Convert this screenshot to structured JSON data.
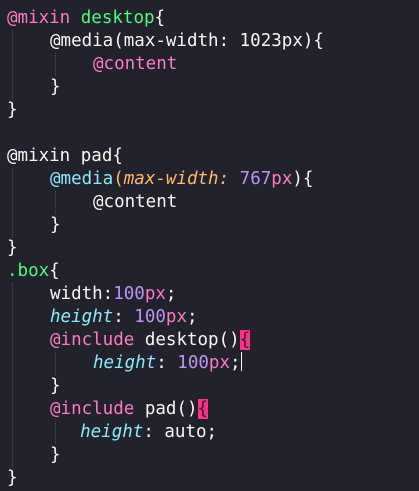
{
  "colors": {
    "background": "#21222c",
    "default_text": "#f8f8f2",
    "pink_keyword": "#ff79c6",
    "green_name": "#50fa7b",
    "cyan_property": "#8be9fd",
    "orange_param": "#ffb86c",
    "purple_number": "#bd93f9",
    "bracket_match_highlight": "#ff2e88",
    "indent_guide": "#4a4c5e"
  },
  "lines": [
    {
      "indent": 0,
      "tokens": [
        {
          "text": "@mixin",
          "color": "#ff79c6"
        },
        {
          "text": " "
        },
        {
          "text": "desktop",
          "color": "#50fa7b"
        },
        {
          "text": "{"
        }
      ]
    },
    {
      "indent": 1,
      "tokens": [
        {
          "text": "@media(max-width: 1023px){"
        }
      ]
    },
    {
      "indent": 2,
      "tokens": [
        {
          "text": "@content",
          "color": "#ff79c6"
        }
      ]
    },
    {
      "indent": 1,
      "tokens": [
        {
          "text": "}"
        }
      ]
    },
    {
      "indent": 0,
      "tokens": [
        {
          "text": "}"
        }
      ]
    },
    {
      "indent": 0,
      "tokens": []
    },
    {
      "indent": 0,
      "tokens": [
        {
          "text": "@mixin pad{"
        }
      ]
    },
    {
      "indent": 1,
      "tokens": [
        {
          "text": "@media",
          "color": "#8be9fd"
        },
        {
          "text": "(",
          "color": "#ffb86c"
        },
        {
          "text": "max-width:",
          "color": "#ffb86c",
          "italic": true
        },
        {
          "text": " "
        },
        {
          "text": "767",
          "color": "#bd93f9"
        },
        {
          "text": "px",
          "color": "#ff79c6"
        },
        {
          "text": "){"
        }
      ]
    },
    {
      "indent": 2,
      "tokens": [
        {
          "text": "@content"
        }
      ]
    },
    {
      "indent": 1,
      "tokens": [
        {
          "text": "}"
        }
      ]
    },
    {
      "indent": 0,
      "tokens": [
        {
          "text": "}"
        }
      ]
    },
    {
      "indent": 0,
      "tokens": [
        {
          "text": ".box",
          "color": "#50fa7b"
        },
        {
          "text": "{"
        }
      ]
    },
    {
      "indent": 1,
      "tokens": [
        {
          "text": "width:"
        },
        {
          "text": "100",
          "color": "#bd93f9"
        },
        {
          "text": "px",
          "color": "#ff79c6"
        },
        {
          "text": ";"
        }
      ]
    },
    {
      "indent": 1,
      "tokens": [
        {
          "text": "height",
          "color": "#8be9fd",
          "italic": true
        },
        {
          "text": ": "
        },
        {
          "text": "100",
          "color": "#bd93f9"
        },
        {
          "text": "px",
          "color": "#ff79c6"
        },
        {
          "text": ";"
        }
      ]
    },
    {
      "indent": 1,
      "tokens": [
        {
          "text": "@include",
          "color": "#ff79c6"
        },
        {
          "text": " desktop()"
        },
        {
          "text": "{",
          "highlight": true
        }
      ]
    },
    {
      "indent": 2,
      "tokens": [
        {
          "text": "height",
          "color": "#8be9fd",
          "italic": true
        },
        {
          "text": ": "
        },
        {
          "text": "100",
          "color": "#bd93f9"
        },
        {
          "text": "px",
          "color": "#ff79c6"
        },
        {
          "text": ";"
        }
      ],
      "cursor": true
    },
    {
      "indent": 1,
      "tokens": [
        {
          "text": "}"
        }
      ]
    },
    {
      "indent": 1,
      "tokens": [
        {
          "text": "@include",
          "color": "#ff79c6"
        },
        {
          "text": " pad()"
        },
        {
          "text": "{",
          "highlight": true
        }
      ]
    },
    {
      "indent": 1.7,
      "tokens": [
        {
          "text": "height",
          "color": "#8be9fd",
          "italic": true
        },
        {
          "text": ": auto;"
        }
      ]
    },
    {
      "indent": 1,
      "tokens": [
        {
          "text": "}"
        }
      ]
    },
    {
      "indent": 0,
      "tokens": [
        {
          "text": "}"
        }
      ]
    }
  ]
}
